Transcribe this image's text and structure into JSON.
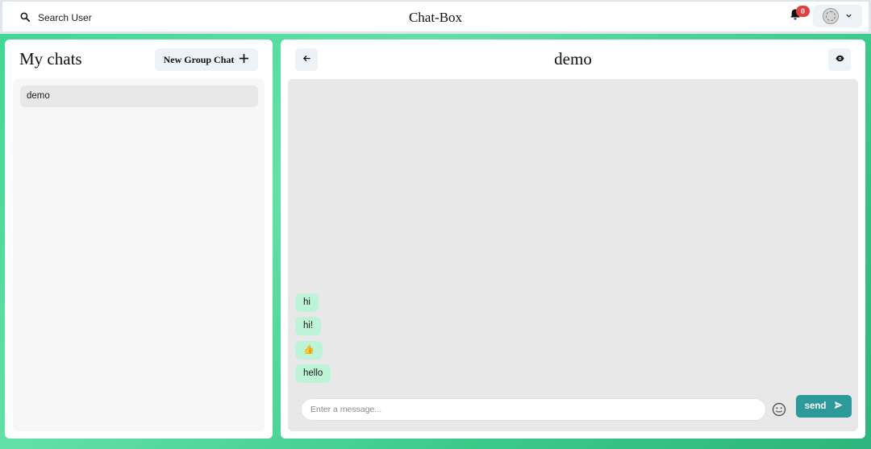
{
  "header": {
    "search_label": "Search User",
    "app_title": "Chat-Box",
    "notification_count": "0"
  },
  "sidebar": {
    "title": "My chats",
    "new_group_label": "New Group Chat",
    "chats": [
      {
        "name": "demo"
      }
    ]
  },
  "chat": {
    "title": "demo",
    "messages": [
      {
        "text": "hi"
      },
      {
        "text": "hi!"
      },
      {
        "text": "👍"
      },
      {
        "text": "hello"
      }
    ],
    "input_placeholder": "Enter a message...",
    "input_value": "",
    "send_label": "send"
  },
  "colors": {
    "accent": "#2c9a9a",
    "message_bubble": "#bdf3d6",
    "badge": "#e53e3e"
  }
}
